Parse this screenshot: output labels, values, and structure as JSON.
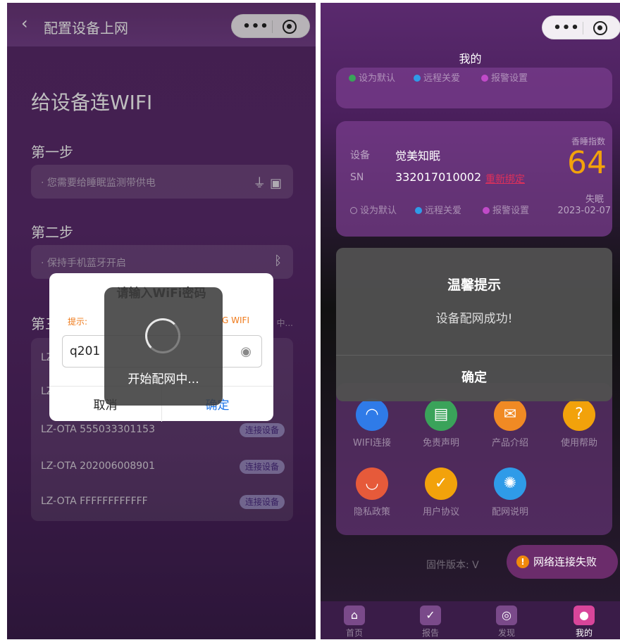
{
  "left": {
    "header_title": "配置设备上网",
    "back_icon": "‹",
    "heading": "给设备连WIFI",
    "step1": "第一步",
    "step1_hint": "· 您需要给睡眠监测带供电",
    "step2": "第二步",
    "step2_hint": "· 保持手机蓝牙开启",
    "step3": "第三",
    "step3_right": "中...",
    "wifi_list": [
      {
        "name": "LZ",
        "button": ""
      },
      {
        "name": "LZ",
        "button": ""
      },
      {
        "name": "LZ-OTA 555033301153",
        "button": "连接设备"
      },
      {
        "name": "LZ-OTA 202006008901",
        "button": "连接设备"
      },
      {
        "name": "LZ-OTA FFFFFFFFFFFF",
        "button": "连接设备"
      }
    ],
    "dialog": {
      "title": "请输入WiFi密码",
      "hint_left": "提示:",
      "hint_right": "G WIFI",
      "password_value": "q201",
      "cancel": "取消",
      "ok": "确定"
    },
    "loading_text": "开始配网中..."
  },
  "right": {
    "title": "我的",
    "card1_tags": [
      "设为默认",
      "远程关爱",
      "报警设置"
    ],
    "device": {
      "label_device": "设备",
      "device_name": "觉美知眠",
      "label_sn": "SN",
      "sn_value": "332017010002",
      "rebind_link": "重新绑定",
      "score_label": "香睡指数",
      "score": "64",
      "status": "失眠",
      "date": "2023-02-07",
      "tags": [
        "设为默认",
        "远程关爱",
        "报警设置"
      ]
    },
    "modal": {
      "title": "温馨提示",
      "body": "设备配网成功!",
      "ok": "确定"
    },
    "tools": [
      {
        "label": "WIFI连接",
        "icon": "wifi-icon",
        "color": "#2f7be8"
      },
      {
        "label": "免责声明",
        "icon": "document-icon",
        "color": "#3aa35a"
      },
      {
        "label": "产品介绍",
        "icon": "product-icon",
        "color": "#f08a24"
      },
      {
        "label": "使用帮助",
        "icon": "help-icon",
        "color": "#f2a20b"
      },
      {
        "label": "隐私政策",
        "icon": "privacy-icon",
        "color": "#e65a3a"
      },
      {
        "label": "用户协议",
        "icon": "agreement-icon",
        "color": "#f2a20b"
      },
      {
        "label": "配网说明",
        "icon": "bulb-icon",
        "color": "#2f9be8"
      }
    ],
    "firmware": "固件版本: V",
    "toast": "网络连接失败",
    "tabs": [
      {
        "label": "首页",
        "icon": "home-icon"
      },
      {
        "label": "报告",
        "icon": "report-icon"
      },
      {
        "label": "发现",
        "icon": "discover-icon"
      },
      {
        "label": "我的",
        "icon": "profile-icon"
      }
    ]
  }
}
